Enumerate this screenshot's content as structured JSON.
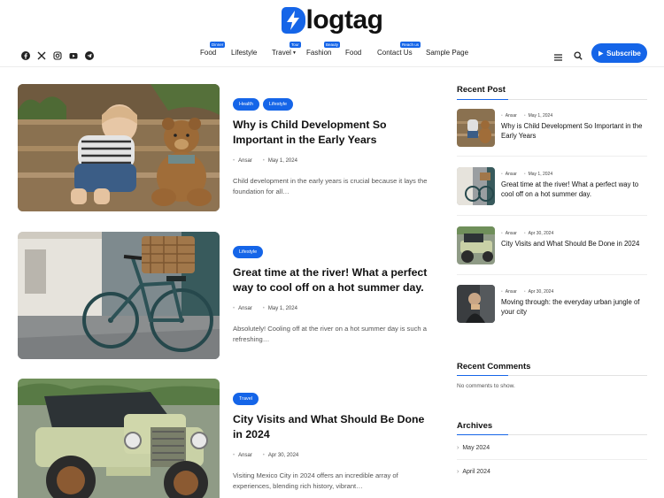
{
  "site": {
    "logo_text": "logtag"
  },
  "nav": [
    {
      "label": "Food",
      "badge": "Dinner"
    },
    {
      "label": "Lifestyle",
      "badge": ""
    },
    {
      "label": "Travel",
      "badge": "Tour"
    },
    {
      "label": "Fashion",
      "badge": "Beauty"
    },
    {
      "label": "Food",
      "badge": ""
    },
    {
      "label": "Contact Us",
      "badge": "Reach us"
    },
    {
      "label": "Sample Page",
      "badge": ""
    }
  ],
  "socials": [
    "facebook-icon",
    "x-icon",
    "instagram-icon",
    "youtube-icon",
    "telegram-icon"
  ],
  "subscribe_label": "Subscribe",
  "accent": "#1565e8",
  "posts": [
    {
      "tags": [
        "Health",
        "Lifestyle"
      ],
      "title": "Why is Child Development So Important in the Early Years",
      "author": "Ansar",
      "date": "May 1, 2024",
      "excerpt": "Child development in the early years is crucial because it lays the foundation for all…"
    },
    {
      "tags": [
        "Lifestyle"
      ],
      "title": "Great time at the river! What a perfect way to cool off on a hot summer day.",
      "author": "Ansar",
      "date": "May 1, 2024",
      "excerpt": "Absolutely! Cooling off at the river on a hot summer day is such a refreshing…"
    },
    {
      "tags": [
        "Travel"
      ],
      "title": "City Visits and What Should Be Done in 2024",
      "author": "Ansar",
      "date": "Apr 30, 2024",
      "excerpt": "Visiting Mexico City in 2024 offers an incredible array of experiences, blending rich history, vibrant…"
    }
  ],
  "sidebar": {
    "recent_heading": "Recent Post",
    "recent": [
      {
        "author": "Ansar",
        "date": "May 1, 2024",
        "title": "Why is Child Development So Important in the Early Years"
      },
      {
        "author": "Ansar",
        "date": "May 1, 2024",
        "title": "Great time at the river! What a perfect way to cool off on a hot summer day."
      },
      {
        "author": "Ansar",
        "date": "Apr 30, 2024",
        "title": "City Visits and What Should Be Done in 2024"
      },
      {
        "author": "Ansar",
        "date": "Apr 30, 2024",
        "title": "Moving through: the everyday urban jungle of your city"
      }
    ],
    "comments_heading": "Recent Comments",
    "comments_text": "No comments to show.",
    "archives_heading": "Archives",
    "archives": [
      "May 2024",
      "April 2024"
    ]
  }
}
